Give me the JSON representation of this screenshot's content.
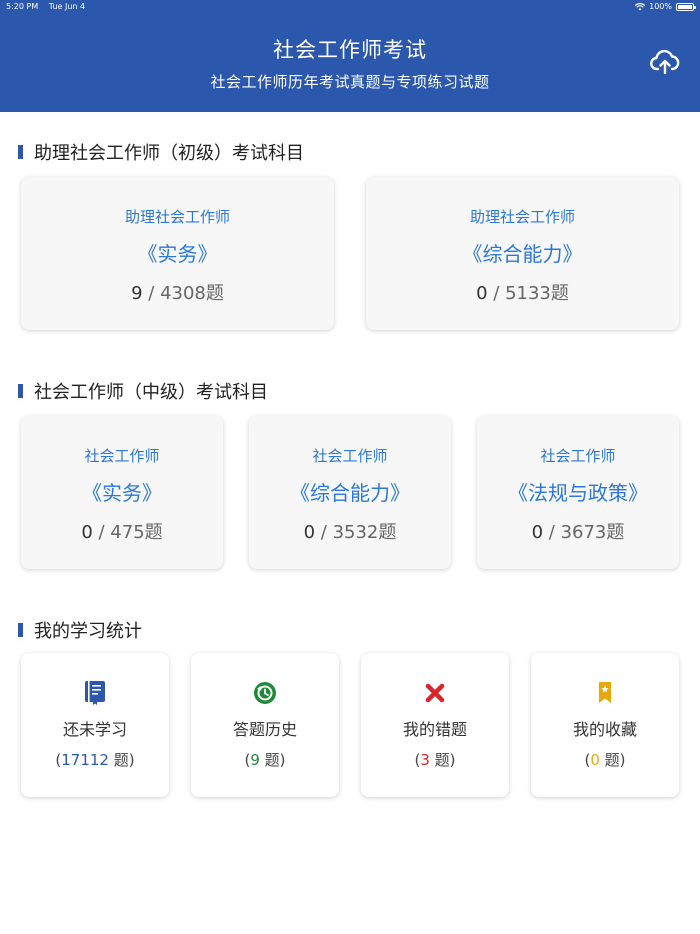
{
  "status_bar": {
    "time": "5:20 PM",
    "date": "Tue Jun 4",
    "battery": "100%"
  },
  "header": {
    "title": "社会工作师考试",
    "subtitle": "社会工作师历年考试真题与专项练习试题",
    "upload_icon": "cloud-upload-icon"
  },
  "section_primary": {
    "title": "助理社会工作师（初级）考试科目",
    "cards": [
      {
        "level": "助理社会工作师",
        "subject": "《实务》",
        "done": "9",
        "separator": " / ",
        "total": "4308题"
      },
      {
        "level": "助理社会工作师",
        "subject": "《综合能力》",
        "done": "0",
        "separator": " / ",
        "total": "5133题"
      }
    ]
  },
  "section_middle": {
    "title": "社会工作师（中级）考试科目",
    "cards": [
      {
        "level": "社会工作师",
        "subject": "《实务》",
        "done": "0",
        "separator": " / ",
        "total": "475题"
      },
      {
        "level": "社会工作师",
        "subject": "《综合能力》",
        "done": "0",
        "separator": " / ",
        "total": "3532题"
      },
      {
        "level": "社会工作师",
        "subject": "《法规与政策》",
        "done": "0",
        "separator": " / ",
        "total": "3673题"
      }
    ]
  },
  "section_stats": {
    "title": "我的学习统计",
    "items": [
      {
        "label": "还未学习",
        "open": "(",
        "value": "17112",
        "unit": " 题)",
        "color": "#2b58ad",
        "icon": "book-icon"
      },
      {
        "label": "答题历史",
        "open": "(",
        "value": "9",
        "unit": " 题)",
        "color": "#1e8a3a",
        "icon": "history-icon"
      },
      {
        "label": "我的错题",
        "open": "(",
        "value": "3",
        "unit": " 题)",
        "color": "#d9252b",
        "icon": "wrong-icon"
      },
      {
        "label": "我的收藏",
        "open": "(",
        "value": "0",
        "unit": " 题)",
        "color": "#e8a80c",
        "icon": "bookmark-icon"
      }
    ]
  }
}
